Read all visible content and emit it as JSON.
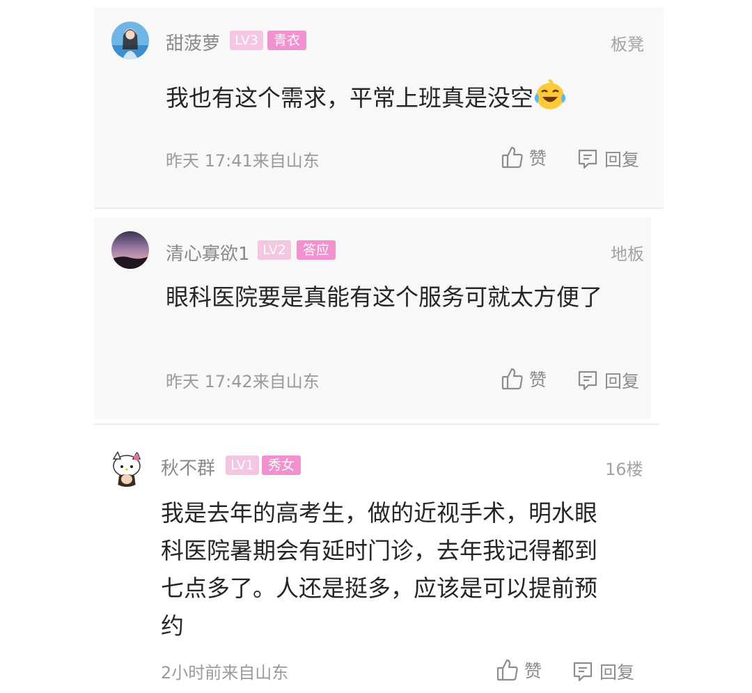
{
  "comments": [
    {
      "username": "甜菠萝",
      "level": "LV3",
      "title_badge": "青衣",
      "floor": "板凳",
      "text": "我也有这个需求，平常上班真是没空",
      "emoji": "laughing-crying-emoji",
      "time_location": "昨天 17:41来自山东",
      "like_label": "赞",
      "reply_label": "回复"
    },
    {
      "username": "清心寡欲1",
      "level": "LV2",
      "title_badge": "答应",
      "floor": "地板",
      "text": "眼科医院要是真能有这个服务可就太方便了",
      "time_location": "昨天 17:42来自山东",
      "like_label": "赞",
      "reply_label": "回复"
    },
    {
      "username": "秋不群",
      "level": "LV1",
      "title_badge": "秀女",
      "floor": "16楼",
      "text": "我是去年的高考生，做的近视手术，明水眼科医院暑期会有延时门诊，去年我记得都到七点多了。人还是挺多，应该是可以提前预约",
      "time_location": "2小时前来自山东",
      "like_label": "赞",
      "reply_label": "回复"
    }
  ],
  "colors": {
    "level_badge": "#f4c6e2",
    "title_badge": "#f291cf",
    "card_bg": "#f8f8f8"
  }
}
